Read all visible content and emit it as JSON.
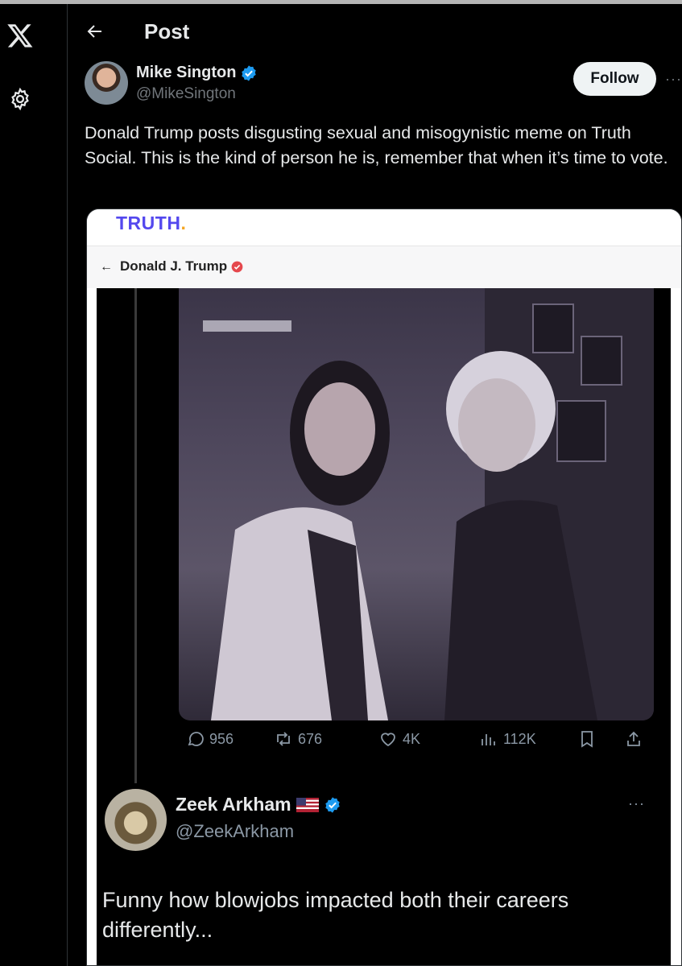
{
  "header": {
    "title": "Post"
  },
  "author": {
    "name": "Mike Sington",
    "handle": "@MikeSington",
    "follow_label": "Follow",
    "more": "···"
  },
  "post": {
    "text": "Donald Trump posts disgusting sexual and misogynistic meme on Truth Social. This is the kind of person he is, remember that when it’s time to vote."
  },
  "embed": {
    "logo_text": "TRUTH",
    "logo_dot": ".",
    "back": "←",
    "user_name": "Donald J. Trump",
    "inner_actions": {
      "replies": "956",
      "reposts": "676",
      "likes": "4K",
      "views": "112K"
    },
    "reply": {
      "name": "Zeek Arkham",
      "handle": "@ZeekArkham",
      "more": "···",
      "text": "Funny how blowjobs impacted both their careers differently..."
    }
  },
  "colors": {
    "background": "#000000",
    "verified": "#1d9bf0",
    "truth_brand": "#5448ee",
    "follow_bg": "#eff3f4"
  }
}
